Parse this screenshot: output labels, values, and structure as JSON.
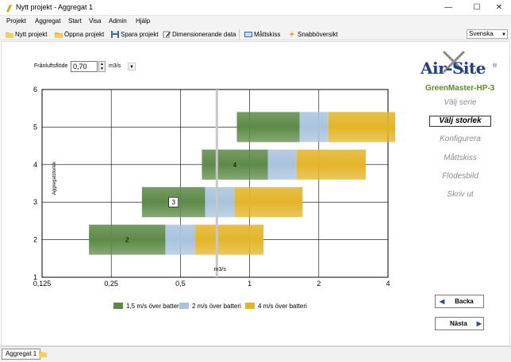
{
  "window": {
    "title": "Nytt projekt - Aggregat 1",
    "minimize": "—",
    "maximize": "☐",
    "close": "✕"
  },
  "menu": [
    "Projekt",
    "Aggregat",
    "Start",
    "Visa",
    "Admin",
    "Hjälp"
  ],
  "toolbar": {
    "new_project": "Nytt projekt",
    "open_project": "Öppna projekt",
    "save_project": "Spara projekt",
    "dimension_data": "Dimensionerande data",
    "dimension_sketch": "Måttskiss",
    "quick_overview": "Snabböversikt",
    "language": "Svenska"
  },
  "airflow": {
    "label": "Frånluftsflöde",
    "value": "0,70",
    "unit": "m3/s"
  },
  "brand": {
    "logo": "Air-Site",
    "model": "GreenMaster-HP-3",
    "primary_color": "#1f3f8a",
    "green_color": "#5c8a2c"
  },
  "steps": {
    "choose_series": "Välj serie",
    "choose_size": "Välj storlek",
    "configure": "Konfigurera",
    "dimension_sketch": "Måttskiss",
    "flow_diagram": "Flödesbild",
    "print": "Skriv ut"
  },
  "nav": {
    "back": "Backa",
    "next": "Nästa"
  },
  "statusbar": {
    "tab": "Aggregat 1"
  },
  "chart_data": {
    "type": "bar",
    "orientation": "horizontal-floating",
    "ylabel": "Aggregatstorlek",
    "xlabel": "m3/s",
    "x_scale": "log2",
    "x_ticks": [
      "0,125",
      "0,25",
      "0,5",
      "1",
      "2",
      "4"
    ],
    "x_tick_values": [
      0.125,
      0.25,
      0.5,
      1,
      2,
      4
    ],
    "xlim": [
      0.125,
      4
    ],
    "ylim": [
      1,
      6
    ],
    "y_ticks": [
      "1",
      "2",
      "3",
      "4",
      "5",
      "6"
    ],
    "grid": true,
    "marker_x": 0.72,
    "legend_position": "bottom",
    "series": [
      {
        "name": "1,5 m/s över batteri",
        "color": "#5e8a48"
      },
      {
        "name": "2 m/s över batteri",
        "color": "#a9c3dd"
      },
      {
        "name": "4 m/s över batteri",
        "color": "#e3b52a"
      }
    ],
    "bars": [
      {
        "size": 2,
        "label": "2",
        "start": 0.2,
        "seg1_end": 0.43,
        "seg2_end": 0.58,
        "end": 1.15
      },
      {
        "size": 3,
        "label": "3",
        "start": 0.34,
        "seg1_end": 0.64,
        "seg2_end": 0.86,
        "end": 1.7
      },
      {
        "size": 4,
        "label": "4",
        "start": 0.62,
        "seg1_end": 1.2,
        "seg2_end": 1.6,
        "end": 3.2
      },
      {
        "size": 5,
        "label": "",
        "start": 0.88,
        "seg1_end": 1.65,
        "seg2_end": 2.2,
        "end": 4.3
      }
    ]
  }
}
